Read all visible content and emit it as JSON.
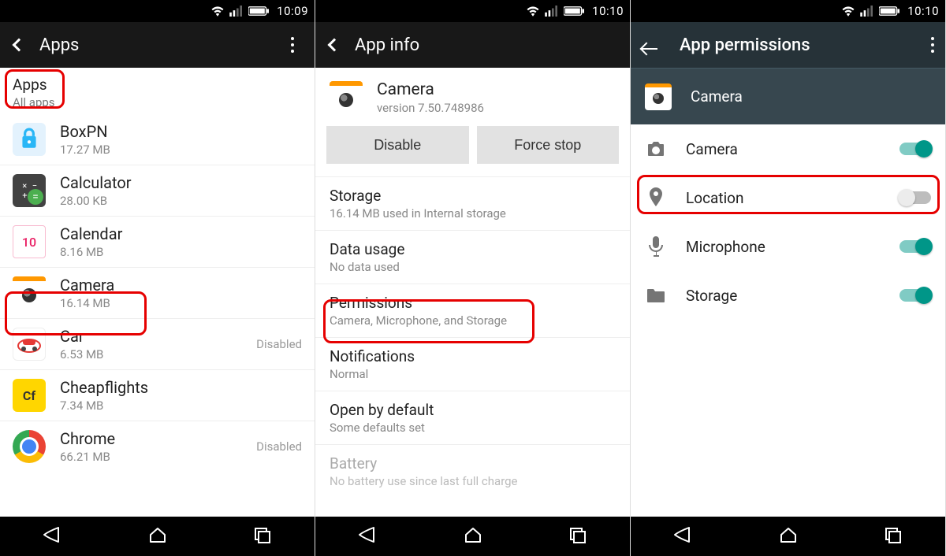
{
  "status": {
    "time1": "10:09",
    "time2": "10:10",
    "time3": "10:10"
  },
  "screen1": {
    "title": "Apps",
    "category_title": "Apps",
    "category_sub": "All apps",
    "apps": [
      {
        "name": "BoxPN",
        "size": "17.27 MB",
        "status": ""
      },
      {
        "name": "Calculator",
        "size": "28.00 KB",
        "status": ""
      },
      {
        "name": "Calendar",
        "size": "8.16 MB",
        "status": ""
      },
      {
        "name": "Camera",
        "size": "16.14 MB",
        "status": ""
      },
      {
        "name": "Car",
        "size": "6.53 MB",
        "status": "Disabled"
      },
      {
        "name": "Cheapflights",
        "size": "7.34 MB",
        "status": ""
      },
      {
        "name": "Chrome",
        "size": "66.21 MB",
        "status": "Disabled"
      }
    ],
    "calendar_day": "10",
    "cheap_abbrev": "Cf"
  },
  "screen2": {
    "title": "App info",
    "app_name": "Camera",
    "app_version": "version 7.50.748986",
    "btn_disable": "Disable",
    "btn_force": "Force stop",
    "rows": [
      {
        "title": "Storage",
        "sub": "16.14 MB used in Internal storage"
      },
      {
        "title": "Data usage",
        "sub": "No data used"
      },
      {
        "title": "Permissions",
        "sub": "Camera, Microphone, and Storage"
      },
      {
        "title": "Notifications",
        "sub": "Normal"
      },
      {
        "title": "Open by default",
        "sub": "Some defaults set"
      },
      {
        "title": "Battery",
        "sub": "No battery use since last full charge"
      }
    ]
  },
  "screen3": {
    "title": "App permissions",
    "app_name": "Camera",
    "perms": [
      {
        "label": "Camera",
        "on": true
      },
      {
        "label": "Location",
        "on": false
      },
      {
        "label": "Microphone",
        "on": true
      },
      {
        "label": "Storage",
        "on": true
      }
    ]
  }
}
